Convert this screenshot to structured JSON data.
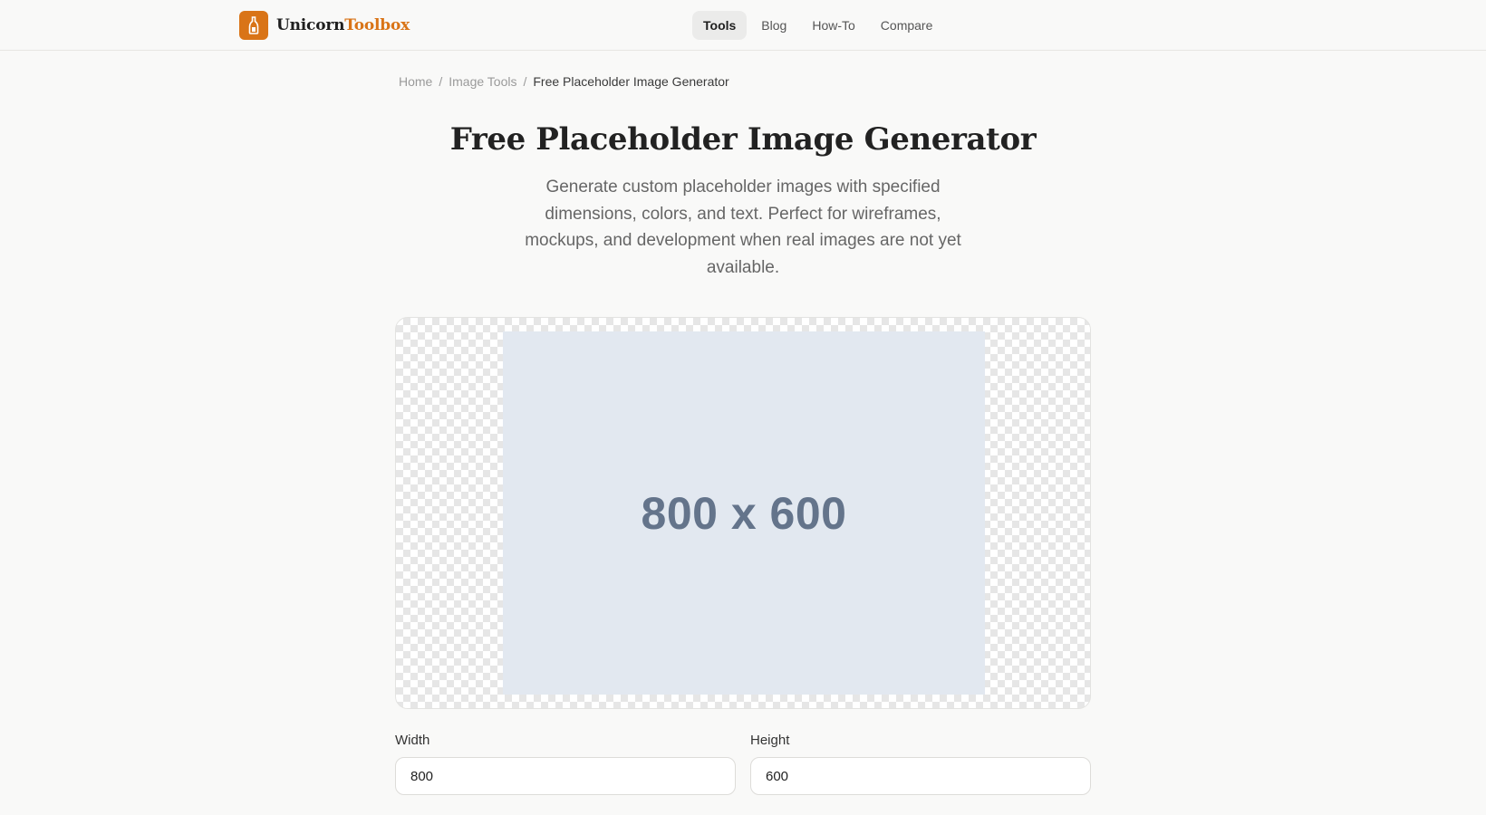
{
  "brand": {
    "name_part1": "Unicorn",
    "name_part2": "Toolbox",
    "accent_color": "#d97417",
    "icon": "bottle-icon"
  },
  "nav": {
    "items": [
      {
        "label": "Tools",
        "active": true
      },
      {
        "label": "Blog",
        "active": false
      },
      {
        "label": "How-To",
        "active": false
      },
      {
        "label": "Compare",
        "active": false
      }
    ]
  },
  "breadcrumb": {
    "items": [
      "Home",
      "Image Tools",
      "Free Placeholder Image Generator"
    ],
    "separator": "/"
  },
  "page": {
    "title": "Free Placeholder Image Generator",
    "subtitle": "Generate custom placeholder images with specified dimensions, colors, and text. Perfect for wireframes, mockups, and development when real images are not yet available."
  },
  "preview": {
    "text": "800 x 600",
    "background_color": "#e2e8f0",
    "text_color": "#64748b"
  },
  "form": {
    "width": {
      "label": "Width",
      "value": "800"
    },
    "height": {
      "label": "Height",
      "value": "600"
    }
  }
}
